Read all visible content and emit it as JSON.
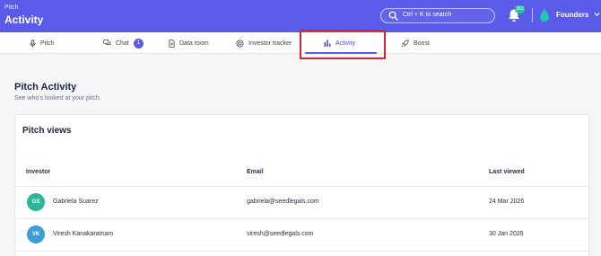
{
  "header": {
    "breadcrumb": "Pitch",
    "title": "Activity",
    "search_placeholder": "Ctrl + K to search",
    "notification_count": "363",
    "org_name": "Founders",
    "colors": {
      "brand": "#5b5bea",
      "badge": "#22c49a",
      "org_icon": "#1ec8b6"
    }
  },
  "tabs": [
    {
      "label": "Pitch",
      "icon": "microphone-icon"
    },
    {
      "label": "Chat",
      "icon": "chat-bubbles-icon",
      "badge": "1"
    },
    {
      "label": "Data room",
      "icon": "document-icon"
    },
    {
      "label": "Investor tracker",
      "icon": "target-icon"
    },
    {
      "label": "Activity",
      "icon": "bar-chart-icon",
      "active": true
    },
    {
      "label": "Boost",
      "icon": "rocket-icon"
    }
  ],
  "section": {
    "title": "Pitch Activity",
    "subtitle": "See who's looked at your pitch."
  },
  "card": {
    "title": "Pitch views",
    "columns": [
      "Investor",
      "Email",
      "Last viewed"
    ],
    "rows": [
      {
        "initials": "GS",
        "name": "Gabriela Suarez",
        "email": "gabriela@seedlegals.com",
        "last_viewed": "24 Mar 2026",
        "avatar_color": "#2fb59a"
      },
      {
        "initials": "VK",
        "name": "Viresh Kanakaratnam",
        "email": "viresh@seedlegals.com",
        "last_viewed": "30 Jan 2025",
        "avatar_color": "#3a9fd6"
      }
    ]
  }
}
